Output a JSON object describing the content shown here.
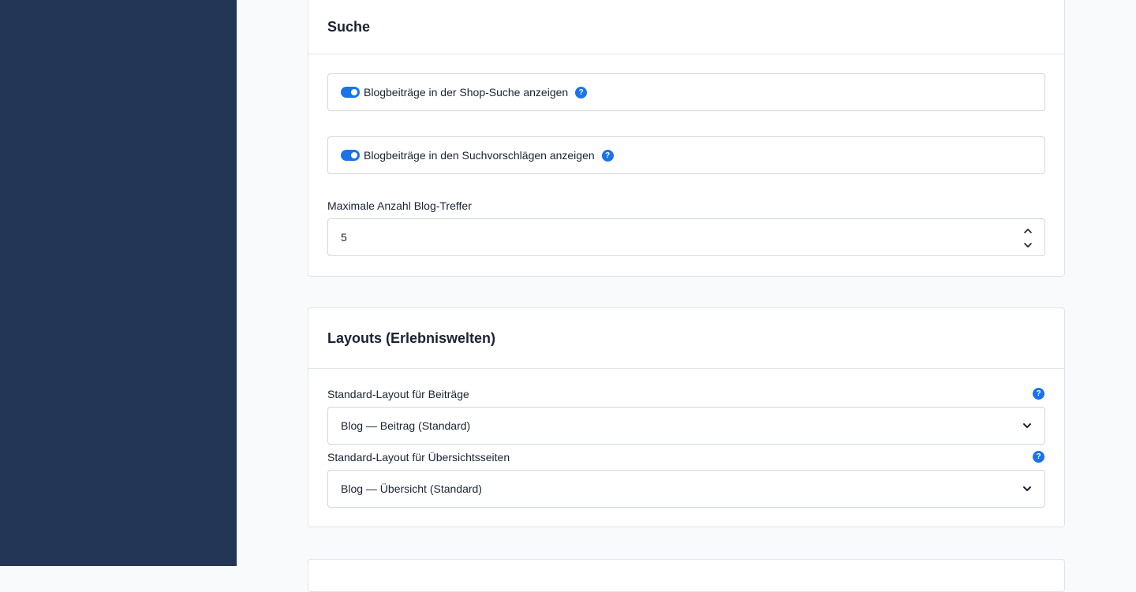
{
  "search_section": {
    "title": "Suche",
    "toggle_shop_search": {
      "label": "Blogbeiträge in der Shop-Suche anzeigen",
      "enabled": true
    },
    "toggle_suggestions": {
      "label": "Blogbeiträge in den Suchvorschlägen anzeigen",
      "enabled": true
    },
    "max_hits": {
      "label": "Maximale Anzahl Blog-Treffer",
      "value": "5"
    },
    "help_glyph": "?"
  },
  "layouts_section": {
    "title": "Layouts (Erlebniswelten)",
    "post_layout": {
      "label": "Standard-Layout für Beiträge",
      "value": "Blog — Beitrag (Standard)"
    },
    "overview_layout": {
      "label": "Standard-Layout für Übersichtsseiten",
      "value": "Blog — Übersicht (Standard)"
    }
  },
  "icons": {
    "help": "question-circle-icon",
    "select": "chevron-down-icon",
    "stepper_up": "chevron-up-icon",
    "stepper_down": "chevron-down-icon"
  },
  "colors": {
    "sidebar": "#243655",
    "accent": "#1a73e8",
    "background": "#f9fafb",
    "border": "#dfe3ea"
  }
}
